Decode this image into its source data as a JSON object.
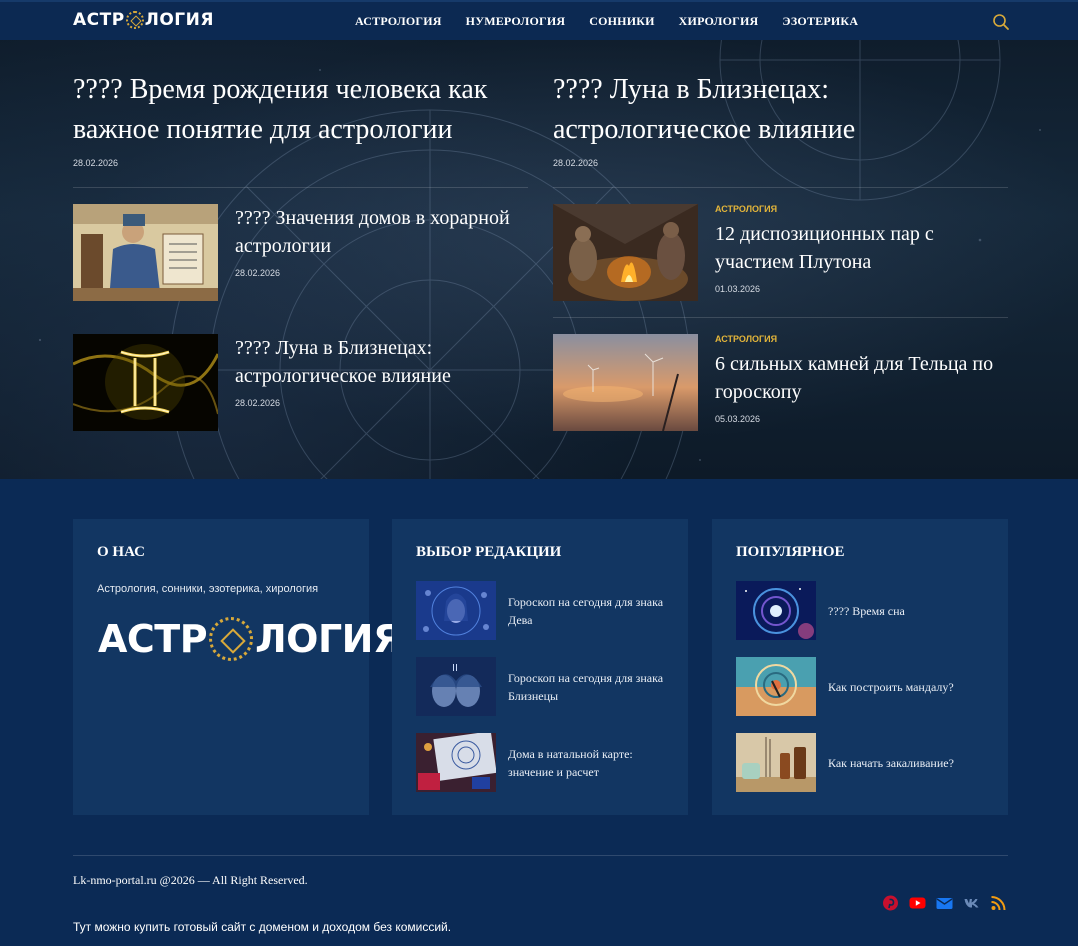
{
  "header": {
    "logo_left": "АСТР",
    "logo_right": "ЛОГИЯ",
    "nav": [
      "АСТРОЛОГИЯ",
      "НУМЕРОЛОГИЯ",
      "СОННИКИ",
      "ХИРОЛОГИЯ",
      "ЭЗОТЕРИКА"
    ],
    "search_icon": "search-icon"
  },
  "hero": {
    "featured": [
      {
        "title": "???? Время рождения человека как важное понятие для астрологии",
        "date": "28.02.2026"
      },
      {
        "title": "???? Луна в Близнецах: астрологическое влияние",
        "date": "28.02.2026"
      }
    ],
    "posts_left": [
      {
        "title": "???? Значения домов в хорарной астрологии",
        "date": "28.02.2026",
        "image": "medieval-astrologer"
      },
      {
        "title": "???? Луна в Близнецах: астрологическое влияние",
        "date": "28.02.2026",
        "image": "gemini-glyph"
      }
    ],
    "posts_right": [
      {
        "category": "АСТРОЛОГИЯ",
        "title": "12 диспозиционных пар с участием Плутона",
        "date": "01.03.2026",
        "image": "campfire"
      },
      {
        "category": "АСТРОЛОГИЯ",
        "title": "6 сильных камней для Тельца по гороскопу",
        "date": "05.03.2026",
        "image": "sunset-windmills"
      }
    ]
  },
  "widgets": {
    "about": {
      "title": "О НАС",
      "text": "Астрология, сонники, эзотерика, хирология",
      "logo_left": "АСТР",
      "logo_right": "ЛОГИЯ"
    },
    "editors": {
      "title": "ВЫБОР РЕДАКЦИИ",
      "items": [
        {
          "title": "Гороскоп на сегодня для знака Дева",
          "image": "virgo-blue"
        },
        {
          "title": "Гороскоп на сегодня для знака Близнецы",
          "image": "gemini-blue"
        },
        {
          "title": "Дома в натальной карте: значение и расчет",
          "image": "natal-chart"
        }
      ]
    },
    "popular": {
      "title": "ПОПУЛЯРНОЕ",
      "items": [
        {
          "title": "???? Время сна",
          "image": "galaxy"
        },
        {
          "title": "Как построить мандалу?",
          "image": "mandala"
        },
        {
          "title": "Как начать закаливание?",
          "image": "spa-bottles"
        }
      ]
    }
  },
  "footer": {
    "copyright": "Lk-nmo-portal.ru @2026 — All Right Reserved.",
    "buy_text": "Тут можно купить готовый сайт с доменом и доходом без комиссий.",
    "socials": [
      {
        "name": "pinterest-icon",
        "color": "#c8102e"
      },
      {
        "name": "youtube-icon",
        "color": "#ff0000"
      },
      {
        "name": "email-icon",
        "color": "#1877f2"
      },
      {
        "name": "vk-icon",
        "color": "#6b8ab8"
      },
      {
        "name": "rss-icon",
        "color": "#f39c12"
      }
    ]
  }
}
